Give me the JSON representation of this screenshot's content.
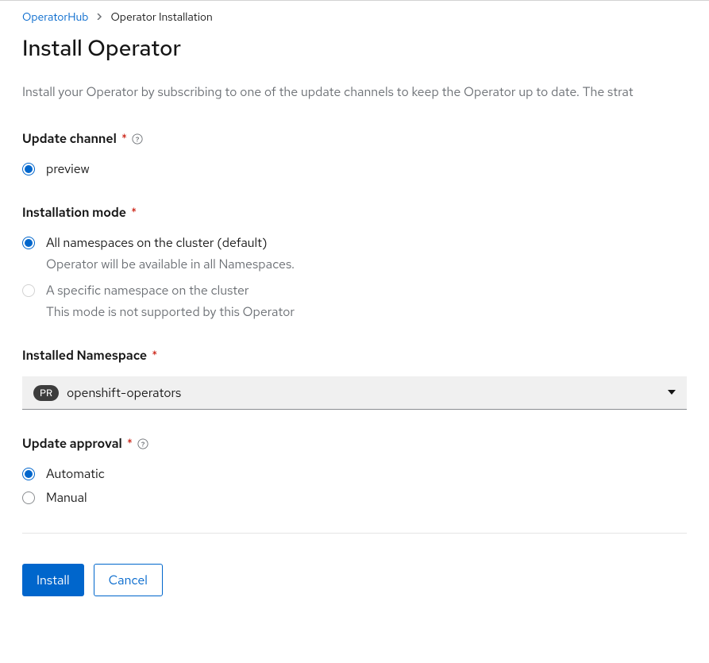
{
  "breadcrumb": {
    "parent": "OperatorHub",
    "current": "Operator Installation"
  },
  "page_title": "Install Operator",
  "intro": "Install your Operator by subscribing to one of the update channels to keep the Operator up to date. The strat",
  "update_channel": {
    "label": "Update channel",
    "options": [
      {
        "value": "preview",
        "checked": true
      }
    ]
  },
  "installation_mode": {
    "label": "Installation mode",
    "options": [
      {
        "label": "All namespaces on the cluster (default)",
        "desc": "Operator will be available in all Namespaces.",
        "checked": true,
        "disabled": false
      },
      {
        "label": "A specific namespace on the cluster",
        "desc": "This mode is not supported by this Operator",
        "checked": false,
        "disabled": true
      }
    ]
  },
  "installed_namespace": {
    "label": "Installed Namespace",
    "badge": "PR",
    "value": "openshift-operators"
  },
  "update_approval": {
    "label": "Update approval",
    "options": [
      {
        "label": "Automatic",
        "checked": true
      },
      {
        "label": "Manual",
        "checked": false
      }
    ]
  },
  "buttons": {
    "install": "Install",
    "cancel": "Cancel"
  }
}
